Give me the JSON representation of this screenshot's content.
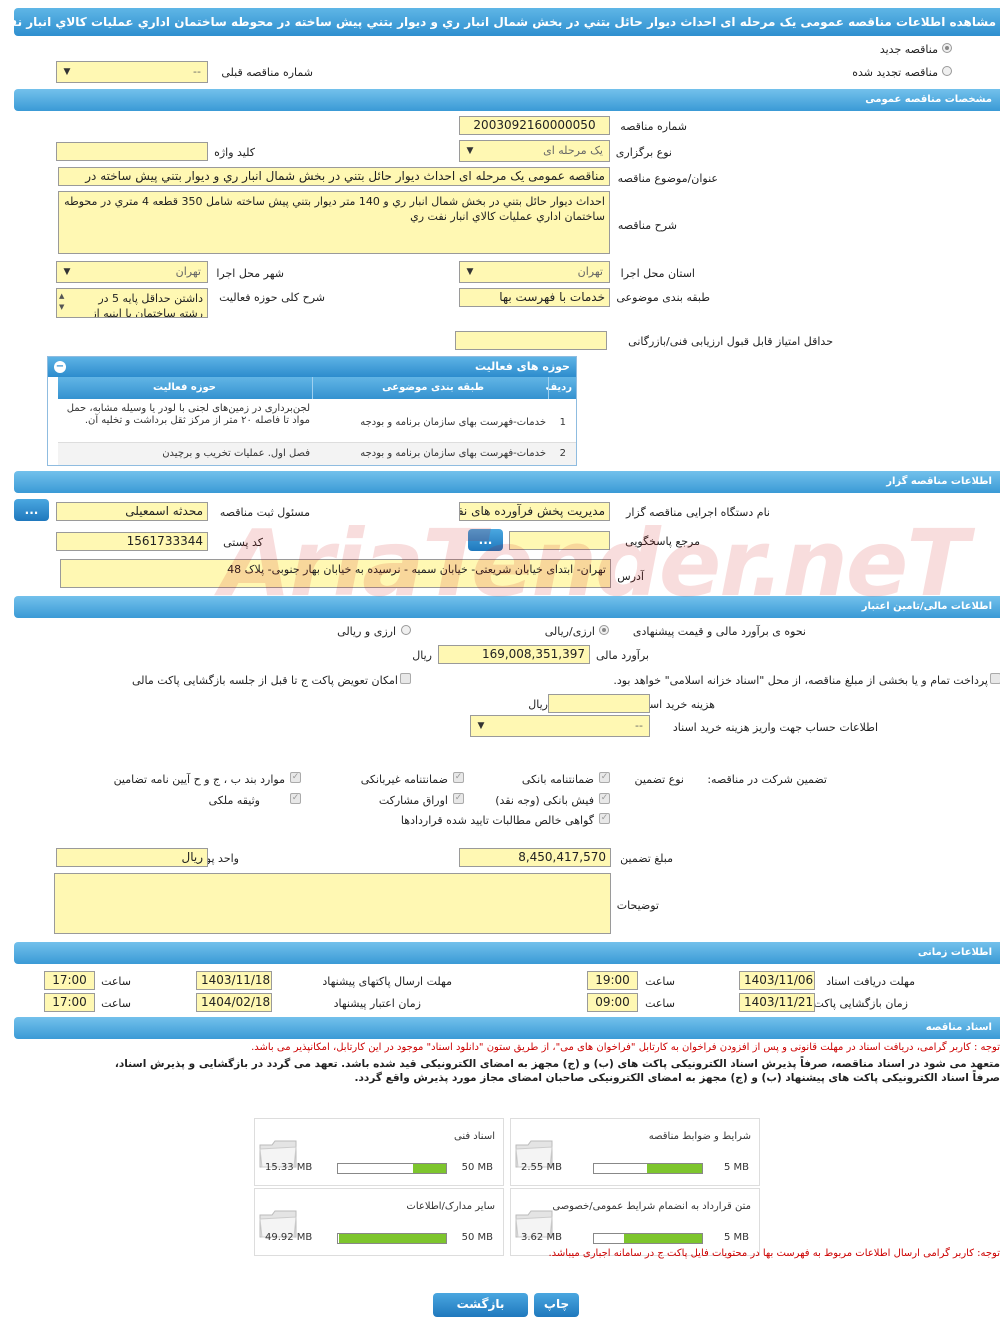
{
  "title": "مشاهده اطلاعات مناقصه عمومی یک مرحله ای احداث ديوار حائل بتني در بخش شمال انبار ري و ديوار بتني پيش ساخته در محوطه ساختمان اداري عمليات كالاي انبار نفت ري",
  "type": {
    "new": "مناقصه جدید",
    "renew": "مناقصه تجدید شده",
    "prev_label": "شماره مناقصه قبلی",
    "prev_value": "--"
  },
  "general": {
    "header": "مشخصات مناقصه عمومی",
    "number_label": "شماره مناقصه",
    "number": "2003092160000050",
    "keyword_label": "کلید واژه",
    "keyword": "",
    "kind_label": "نوع برگزاری",
    "kind": "یک مرحله ای",
    "subject_label": "عنوان/موضوع مناقصه",
    "subject": "مناقصه عمومی یک مرحله ای احداث ديوار حائل بتني در بخش شمال انبار ري و  ديوار بتني پيش ساخته در",
    "desc_label": "شرح مناقصه",
    "desc": "احداث ديوار حائل بتني در بخش شمال انبار ري و 140 متر ديوار بتني پيش ساخته شامل 350 قطعه 4 متري در محوطه ساختمان اداري عمليات كالاي انبار نفت ري",
    "province_label": "استان محل اجرا",
    "province": "تهران",
    "city_label": "شهر محل اجرا",
    "city": "تهران",
    "category_label": "طبقه بندی موضوعی",
    "category": "خدمات با فهرست بها",
    "scope_label": "شرح کلی حوزه فعالیت",
    "scope": "داشتن حداقل پایه 5 در رشته ساختمان یا ابنیه از",
    "min_score_label": "حداقل امتیاز قابل قبول ارزیابی فنی/بازرگانی",
    "min_score": ""
  },
  "activities": {
    "header": "حوزه های فعالیت",
    "cols": [
      "ردیف",
      "طبقه بندی موضوعی",
      "حوزه فعالیت"
    ],
    "rows": [
      {
        "n": "1",
        "cat": "خدمات-فهرست بهای سازمان برنامه و بودجه",
        "area": "لجن‌برداری در زمین‌های لجنی با لودر یا وسیله مشابه، حمل مواد تا فاصله ۲۰ متر از مرکز ثقل برداشت و تخلیه آن."
      },
      {
        "n": "2",
        "cat": "خدمات-فهرست بهای سازمان برنامه و بودجه",
        "area": "فصل اول. عملیات تخریب و برچیدن"
      }
    ]
  },
  "org": {
    "header": "اطلاعات مناقصه گزار",
    "name_label": "نام دستگاه اجرایی مناقصه گزار",
    "name": "مدیریت پخش فرآورده های نفتی",
    "resp_label": "مسئول ثبت مناقصه",
    "resp": "محدثه اسمعیلی",
    "ref_label": "مرجع پاسخگویی",
    "ref": "",
    "postal_label": "کد پستی",
    "postal": "1561733344",
    "address_label": "آدرس",
    "address": "تهران- ابتدای خیابان شریعتی- خیابان سمیه - نرسیده به خیابان بهار جنوبی- پلاک 48",
    "btn": "..."
  },
  "finance": {
    "header": "اطلاعات مالی/تامین اعتبار",
    "method_label": "نحوه ی برآورد مالی و قیمت پیشنهادی",
    "m1": "ارزی/ریالی",
    "m2": "ارزی و ریالی",
    "est_label": "برآورد مالی",
    "est": "169,008,351,397",
    "rial": "ریال",
    "pay_text": "پرداخت تمام و یا بخشی از مبلغ مناقصه، از محل \"اسناد خزانه اسلامی\" خواهد بود.",
    "swap_text": "امکان تعویض پاکت ج تا قبل از جلسه بازگشایی پاکت مالی",
    "doc_cost_label": "هزینه خرید اسناد",
    "doc_cost": "",
    "account_label": "اطلاعات حساب جهت واریز هزینه خرید اسناد",
    "account": "--"
  },
  "guarantee": {
    "label": "تضمین شرکت در مناقصه:",
    "type_label": "نوع تضمین",
    "items": [
      "ضمانتنامه بانکی",
      "ضمانتنامه غیربانکی",
      "موارد بند ب ، ج و ح آیین نامه تضامین",
      "فیش بانکی (وجه نقد)",
      "اوراق مشارکت",
      "وثیقه ملکی",
      "گواهی خالص مطالبات تایید شده قراردادها"
    ],
    "amount_label": "مبلغ تضمین",
    "amount": "8,450,417,570",
    "unit_label": "واحد پول",
    "unit": "ریال",
    "notes_label": "توضیحات",
    "notes": ""
  },
  "time": {
    "header": "اطلاعات زمانی",
    "recv_label": "مهلت دریافت اسناد",
    "recv_date": "1403/11/06",
    "recv_time": "19:00",
    "send_label": "مهلت ارسال پاکتهای پیشنهاد",
    "send_date": "1403/11/18",
    "send_time": "17:00",
    "open_label": "زمان بازگشایی پاکت ها",
    "open_date": "1403/11/21",
    "open_time": "09:00",
    "valid_label": "زمان اعتبار پیشنهاد",
    "valid_date": "1404/02/18",
    "valid_time": "17:00",
    "time_label": "ساعت"
  },
  "docs": {
    "header": "اسناد مناقصه",
    "note1": "توجه : کاربر گرامی، دریافت اسناد در مهلت قانونی و پس از افزودن فراخوان به کارتابل \"فراخوان های می\"، از طریق ستون \"دانلود اسناد\" موجود در این کارتابل، امکانپذیر می باشد.",
    "note2": "متعهد می شود در اسناد مناقصه، صرفاً پذیرش اسناد الکترونیکی پاکت های (ب) و (ج) مجهز به امضای الکترونیکی قید شده باشد. تعهد می گردد در بازگشایی و پذیرش اسناد،",
    "note3": "صرفاً اسناد الکترونیکی پاکت های پیشنهاد (ب) و (ج) مجهز به امضای الکترونیکی صاحبان امضای مجاز مورد پذیرش واقع گردد.",
    "files": [
      {
        "name": "شرایط و ضوابط مناقصه",
        "size": "2.55 MB",
        "max": "5 MB",
        "pct": 51
      },
      {
        "name": "اسناد فنی",
        "size": "15.33 MB",
        "max": "50 MB",
        "pct": 31
      },
      {
        "name": "متن قرارداد به انضمام شرایط عمومی/خصوصی",
        "size": "3.62 MB",
        "max": "5 MB",
        "pct": 72
      },
      {
        "name": "سایر مدارک/اطلاعات",
        "size": "49.92 MB",
        "max": "50 MB",
        "pct": 99
      }
    ],
    "note4": "توجه: کاربر گرامی ارسال اطلاعات مربوط به فهرست بها در محتویات فایل پاکت ج در سامانه اجباری میباشد."
  },
  "buttons": {
    "back": "بازگشت",
    "print": "چاپ"
  },
  "watermark": "AriaTender.neT",
  "colors": {
    "header": "#3a9ad6",
    "input": "#fff8b3",
    "note": "#cc0000",
    "progress": "#7dc52d"
  }
}
